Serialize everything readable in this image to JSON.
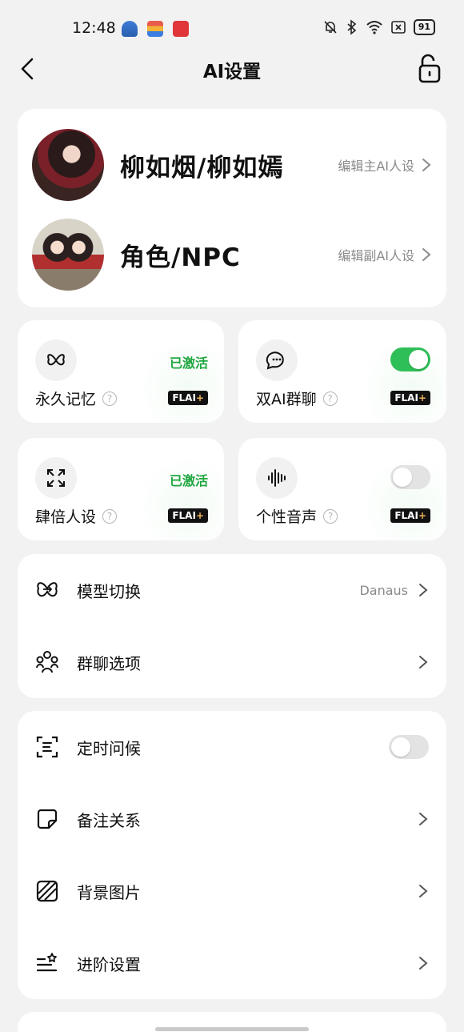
{
  "status_bar": {
    "time": "12:48",
    "battery": "91"
  },
  "header": {
    "title": "AI设置"
  },
  "characters": [
    {
      "name": "柳如烟/柳如嫣",
      "edit_label": "编辑主AI人设"
    },
    {
      "name": "角色/NPC",
      "edit_label": "编辑副AI人设"
    }
  ],
  "tiles": {
    "memory": {
      "label": "永久记忆",
      "status": "已激活",
      "badge_main": "FLAI",
      "badge_plus": "+"
    },
    "dual_ai": {
      "label": "双AI群聊",
      "toggle": true,
      "badge_main": "FLAI",
      "badge_plus": "+"
    },
    "persona": {
      "label": "肆倍人设",
      "status": "已激活",
      "badge_main": "FLAI",
      "badge_plus": "+"
    },
    "voice": {
      "label": "个性音声",
      "toggle": false,
      "badge_main": "FLAI",
      "badge_plus": "+"
    }
  },
  "help_glyph": "?",
  "group1": [
    {
      "label": "模型切换",
      "value": "Danaus",
      "icon": "model-switch-icon"
    },
    {
      "label": "群聊选项",
      "value": "",
      "icon": "group-icon"
    }
  ],
  "group2": [
    {
      "label": "定时问候",
      "icon": "timer-icon",
      "toggle": false
    },
    {
      "label": "备注关系",
      "icon": "note-icon"
    },
    {
      "label": "背景图片",
      "icon": "image-icon"
    },
    {
      "label": "进阶设置",
      "icon": "advanced-icon"
    }
  ],
  "colors": {
    "accent_green": "#2fbf58",
    "active_text": "#1fa63f"
  }
}
